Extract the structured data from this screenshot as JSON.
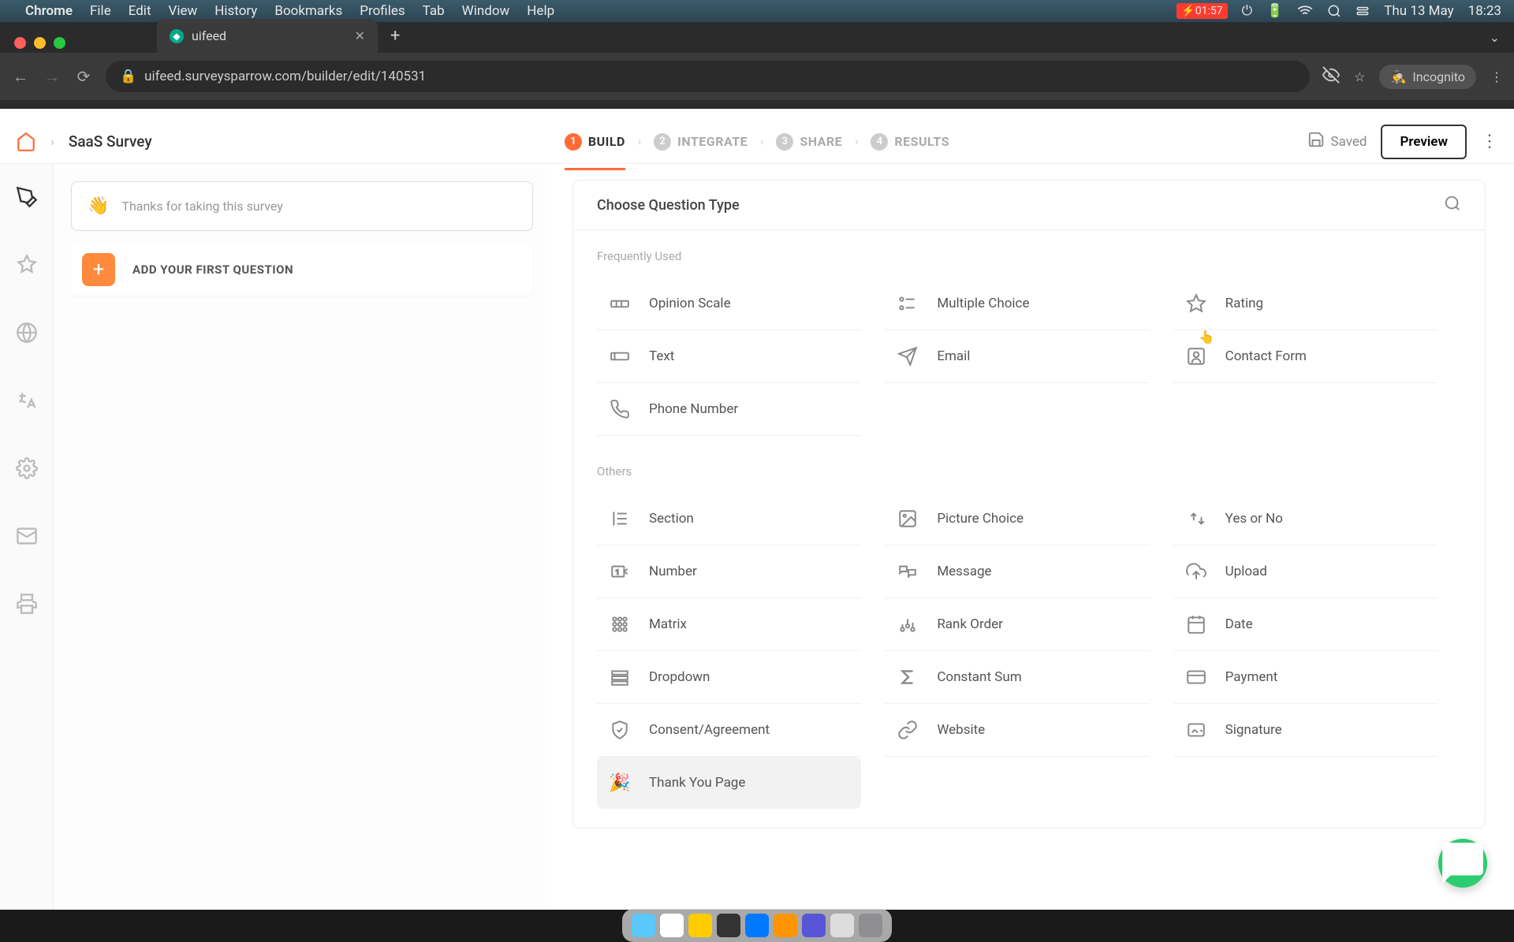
{
  "menubar": {
    "apple": "",
    "app": "Chrome",
    "items": [
      "File",
      "Edit",
      "View",
      "History",
      "Bookmarks",
      "Profiles",
      "Tab",
      "Window",
      "Help"
    ],
    "battery_time": "01:57",
    "date": "Thu 13 May",
    "time": "18:23"
  },
  "browser": {
    "tab_title": "uifeed",
    "url": "uifeed.surveysparrow.com/builder/edit/140531",
    "incognito_label": "Incognito"
  },
  "header": {
    "survey_title": "SaaS Survey",
    "steps": [
      {
        "num": "1",
        "label": "BUILD"
      },
      {
        "num": "2",
        "label": "INTEGRATE"
      },
      {
        "num": "3",
        "label": "SHARE"
      },
      {
        "num": "4",
        "label": "RESULTS"
      }
    ],
    "saved": "Saved",
    "preview": "Preview"
  },
  "left": {
    "welcome_text": "Thanks for taking this survey",
    "add_label": "ADD YOUR FIRST QUESTION"
  },
  "panel": {
    "title": "Choose Question Type",
    "sections": {
      "freq_label": "Frequently Used",
      "others_label": "Others"
    },
    "frequently": [
      {
        "id": "opinion-scale",
        "label": "Opinion Scale"
      },
      {
        "id": "multiple-choice",
        "label": "Multiple Choice"
      },
      {
        "id": "rating",
        "label": "Rating"
      },
      {
        "id": "text",
        "label": "Text"
      },
      {
        "id": "email",
        "label": "Email"
      },
      {
        "id": "contact-form",
        "label": "Contact Form"
      },
      {
        "id": "phone-number",
        "label": "Phone Number"
      }
    ],
    "others": [
      {
        "id": "section",
        "label": "Section"
      },
      {
        "id": "picture-choice",
        "label": "Picture Choice"
      },
      {
        "id": "yes-or-no",
        "label": "Yes or No"
      },
      {
        "id": "number",
        "label": "Number"
      },
      {
        "id": "message",
        "label": "Message"
      },
      {
        "id": "upload",
        "label": "Upload"
      },
      {
        "id": "matrix",
        "label": "Matrix"
      },
      {
        "id": "rank-order",
        "label": "Rank Order"
      },
      {
        "id": "date",
        "label": "Date"
      },
      {
        "id": "dropdown",
        "label": "Dropdown"
      },
      {
        "id": "constant-sum",
        "label": "Constant Sum"
      },
      {
        "id": "payment",
        "label": "Payment"
      },
      {
        "id": "consent",
        "label": "Consent/Agreement"
      },
      {
        "id": "website",
        "label": "Website"
      },
      {
        "id": "signature",
        "label": "Signature"
      },
      {
        "id": "thank-you",
        "label": "Thank You Page"
      }
    ]
  },
  "dock_colors": [
    "#5ac8fa",
    "#fff",
    "#ffcc00",
    "#333",
    "#007aff",
    "#ff9500",
    "#5856d6",
    "#ddd",
    "#8e8e93"
  ]
}
